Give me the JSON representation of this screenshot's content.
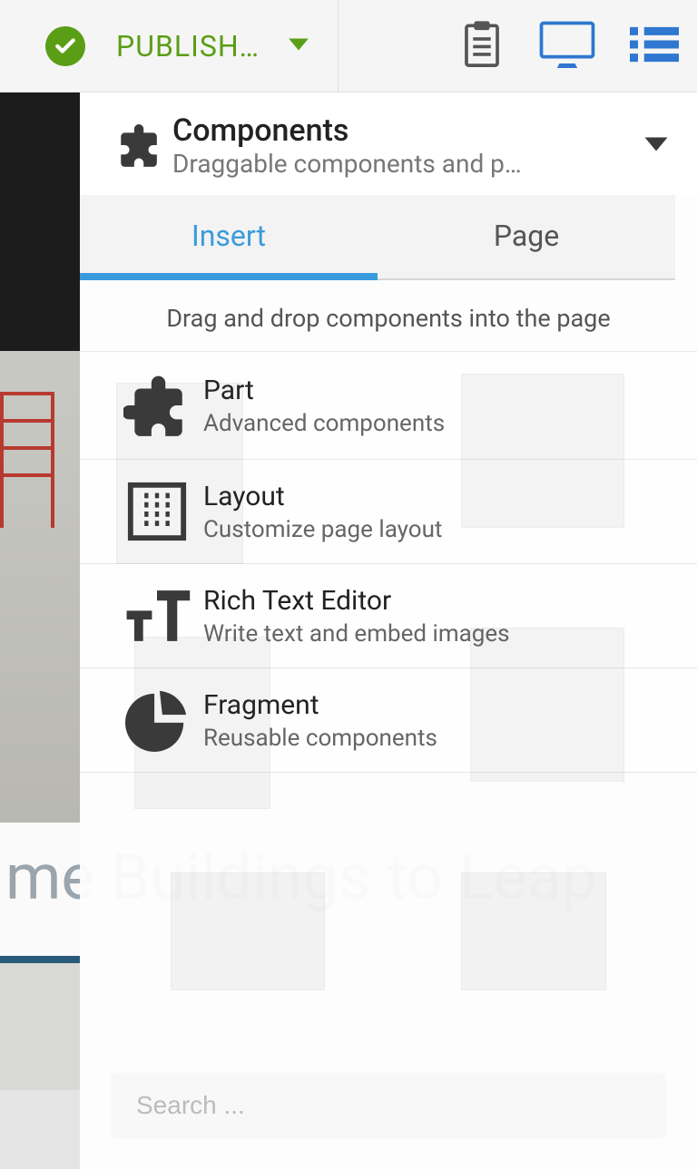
{
  "toolbar": {
    "publish_label": "PUBLISH…"
  },
  "panel": {
    "title": "Components",
    "subtitle": "Draggable components and p…"
  },
  "tabs": {
    "insert": "Insert",
    "page": "Page"
  },
  "hint": "Drag and drop components into the page",
  "components": [
    {
      "title": "Part",
      "desc": "Advanced components",
      "icon": "puzzle"
    },
    {
      "title": "Layout",
      "desc": "Customize page layout",
      "icon": "layout"
    },
    {
      "title": "Rich Text Editor",
      "desc": "Write text and embed images",
      "icon": "text"
    },
    {
      "title": "Fragment",
      "desc": "Reusable components",
      "icon": "pie"
    }
  ],
  "search": {
    "placeholder": "Search ..."
  },
  "preview": {
    "headline_fragment": "me Buildings to Leap"
  }
}
